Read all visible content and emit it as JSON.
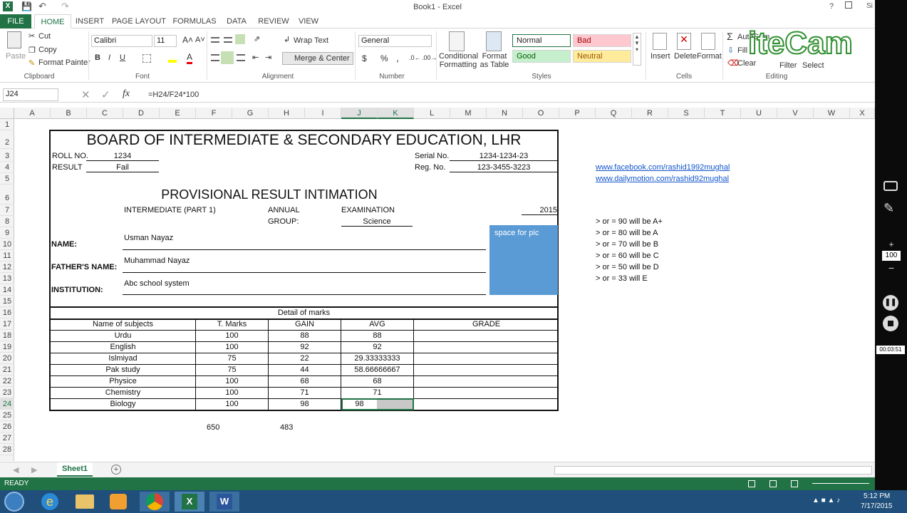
{
  "window": {
    "title": "Book1 - Excel",
    "help": "?",
    "user": "Si"
  },
  "tabs": [
    {
      "label": "FILE"
    },
    {
      "label": "HOME"
    },
    {
      "label": "INSERT"
    },
    {
      "label": "PAGE LAYOUT"
    },
    {
      "label": "FORMULAS"
    },
    {
      "label": "DATA"
    },
    {
      "label": "REVIEW"
    },
    {
      "label": "VIEW"
    }
  ],
  "ribbon": {
    "clipboard": {
      "paste": "Paste",
      "cut": "Cut",
      "copy": "Copy",
      "format_painter": "Format Painter",
      "label": "Clipboard"
    },
    "font": {
      "name": "Calibri",
      "size": "11",
      "bold": "B",
      "italic": "I",
      "underline": "U",
      "label": "Font"
    },
    "alignment": {
      "wrap": "Wrap Text",
      "merge": "Merge & Center",
      "label": "Alignment"
    },
    "number": {
      "format": "General",
      "currency": "$",
      "percent": "%",
      "comma": ",",
      "label": "Number"
    },
    "styles": {
      "conditional": "Conditional Formatting",
      "table": "Format as Table",
      "normal": "Normal",
      "bad": "Bad",
      "good": "Good",
      "neutral": "Neutral",
      "label": "Styles"
    },
    "cells": {
      "insert": "Insert",
      "delete": "Delete",
      "format": "Format",
      "label": "Cells"
    },
    "editing": {
      "autosum": "AutoSum",
      "fill": "Fill",
      "clear": "Clear",
      "sort": "Filter",
      "select": "Select",
      "label": "Editing"
    }
  },
  "formula_bar": {
    "name_box": "J24",
    "fx": "fx",
    "formula": "=H24/F24*100"
  },
  "columns": [
    "A",
    "B",
    "C",
    "D",
    "E",
    "F",
    "G",
    "H",
    "I",
    "J",
    "K",
    "L",
    "M",
    "N",
    "O",
    "P",
    "Q",
    "R",
    "S",
    "T",
    "U",
    "V",
    "W",
    "X"
  ],
  "rows": [
    "1",
    "2",
    "3",
    "4",
    "5",
    "6",
    "7",
    "8",
    "9",
    "10",
    "11",
    "12",
    "13",
    "14",
    "15",
    "16",
    "17",
    "18",
    "19",
    "20",
    "21",
    "22",
    "23",
    "24",
    "25",
    "26",
    "27",
    "28"
  ],
  "sheet": {
    "board": "BOARD OF INTERMEDIATE & SECONDARY EDUCATION, LHR",
    "roll_label": "ROLL NO.",
    "roll": "1234",
    "result_label": "RESULT",
    "result": "Fail",
    "serial_label": "Serial No.",
    "serial": "1234-1234-23",
    "reg_label": "Reg. No.",
    "reg": "123-3455-3223",
    "heading": "PROVISIONAL RESULT INTIMATION",
    "exam_level": "INTERMEDIATE (PART 1)",
    "annual": "ANNUAL",
    "examination": "EXAMINATION",
    "year": "2015",
    "group_label": "GROUP:",
    "group": "Science",
    "name_label": "NAME:",
    "name": "Usman Nayaz",
    "father_label": "FATHER'S NAME:",
    "father": "Muhammad Nayaz",
    "inst_label": "INSTITUTION:",
    "inst": "Abc school system",
    "pic": "space for pic",
    "detail": "Detail of marks",
    "headers": [
      "Name of subjects",
      "T. Marks",
      "GAIN",
      "AVG",
      "GRADE"
    ],
    "subjects": [
      {
        "name": "Urdu",
        "total": "100",
        "gain": "88",
        "avg": "88"
      },
      {
        "name": "English",
        "total": "100",
        "gain": "92",
        "avg": "92"
      },
      {
        "name": "Islmiyad",
        "total": "75",
        "gain": "22",
        "avg": "29.33333333"
      },
      {
        "name": "Pak study",
        "total": "75",
        "gain": "44",
        "avg": "58.66666667"
      },
      {
        "name": "Physice",
        "total": "100",
        "gain": "68",
        "avg": "68"
      },
      {
        "name": "Chemistry",
        "total": "100",
        "gain": "71",
        "avg": "71"
      },
      {
        "name": "Biology",
        "total": "100",
        "gain": "98",
        "avg": "98"
      }
    ],
    "sum_total": "650",
    "sum_gain": "483",
    "links": [
      "www.facebook.com/rashid1992mughal",
      "www.dailymotion.com/rashid92mughal"
    ],
    "rules": [
      "> or = 90 will be A+",
      "> or = 80 will be A",
      "> or = 70 will be B",
      "> or = 60 will be C",
      "> or = 50 will be D",
      "> or = 33 will E"
    ]
  },
  "sheet_tab": "Sheet1",
  "status": {
    "ready": "READY"
  },
  "taskbar": {
    "time": "5:12 PM",
    "date": "7/17/2015"
  },
  "recorder": {
    "zoom": "100",
    "timer": "00:03:51",
    "plus": "+",
    "minus": "−",
    "brand": "iteCam"
  },
  "colors": {
    "excel_green": "#217346",
    "pic_blue": "#5b9bd5",
    "link": "#1155cc"
  }
}
